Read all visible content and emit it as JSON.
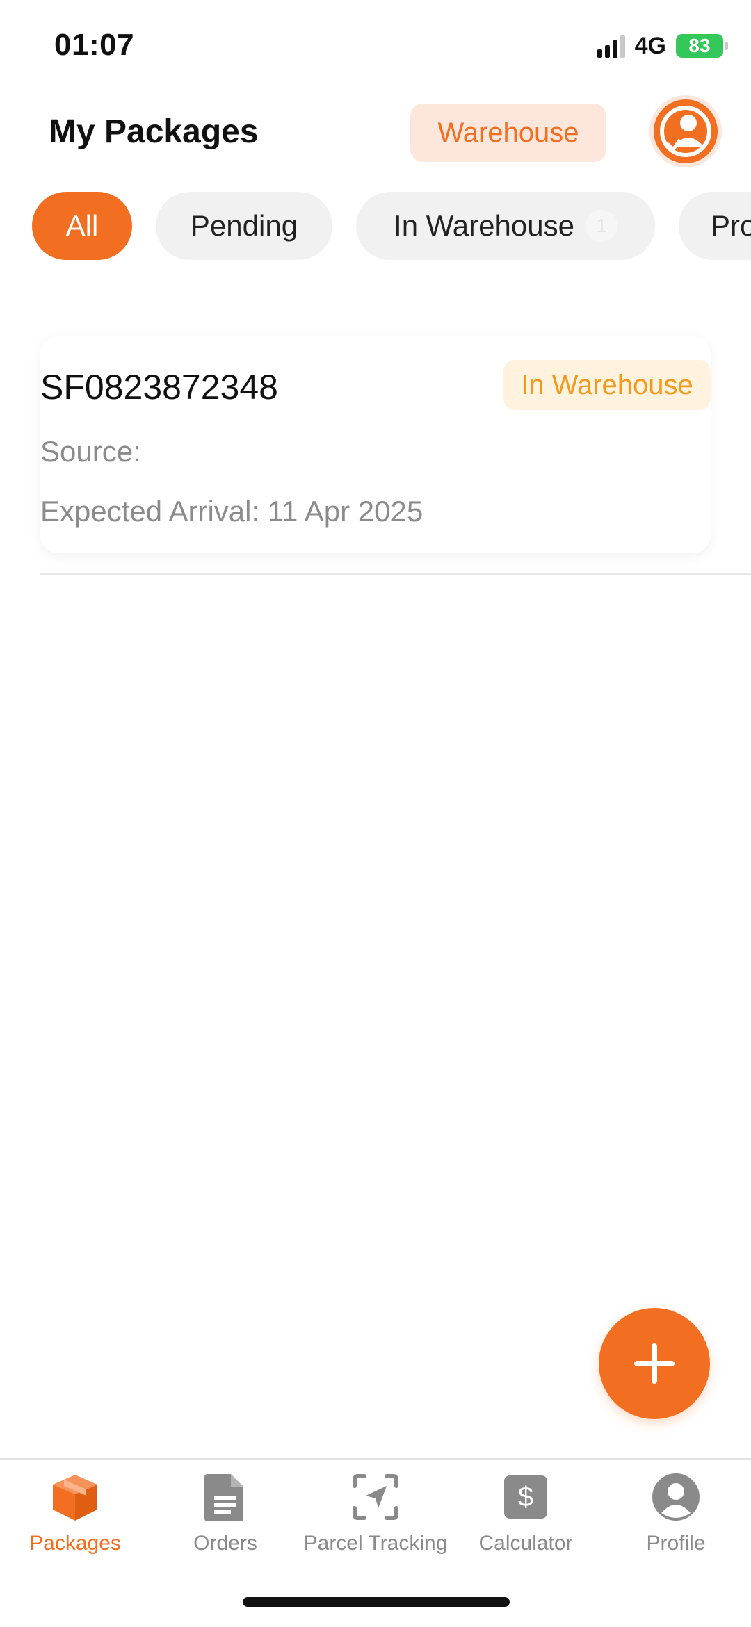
{
  "status_bar": {
    "time": "01:07",
    "network": "4G",
    "battery": "83"
  },
  "header": {
    "title": "My Packages",
    "warehouse_button": "Warehouse",
    "avatar_icon": "user-avatar-icon"
  },
  "filters": {
    "chips": [
      {
        "label": "All",
        "active": true
      },
      {
        "label": "Pending",
        "active": false
      },
      {
        "label": "In Warehouse",
        "count": "1",
        "active": false
      },
      {
        "label": "Pro",
        "active": false
      }
    ]
  },
  "packages": [
    {
      "tracking_number": "SF0823872348",
      "status": "In Warehouse",
      "source": "Source:",
      "expected_arrival": "Expected Arrival: 11 Apr 2025"
    }
  ],
  "fab": {
    "icon": "plus-icon"
  },
  "tabbar": {
    "tabs": [
      {
        "label": "Packages",
        "icon": "package-box-icon",
        "active": true
      },
      {
        "label": "Orders",
        "icon": "document-icon",
        "active": false
      },
      {
        "label": "Parcel Tracking",
        "icon": "navigation-arrow-icon",
        "active": false
      },
      {
        "label": "Calculator",
        "icon": "dollar-icon",
        "active": false
      },
      {
        "label": "Profile",
        "icon": "profile-icon",
        "active": false
      }
    ]
  },
  "colors": {
    "accent": "#f26f21",
    "accent_light": "#fde6dc",
    "badge_bg": "#fff3e0",
    "badge_text": "#f39a1c",
    "battery": "#34c759"
  }
}
